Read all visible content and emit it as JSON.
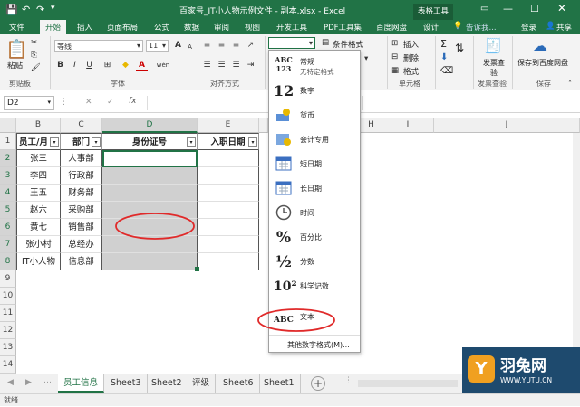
{
  "title": "百家号_IT小人物示例文件 - 副本.xlsx - Excel",
  "context_tab": "表格工具",
  "tabs": [
    "文件",
    "开始",
    "插入",
    "页面布局",
    "公式",
    "数据",
    "审阅",
    "视图",
    "开发工具",
    "PDF工具集",
    "百度网盘",
    "设计"
  ],
  "tell_me": "告诉我...",
  "login": "登录",
  "share": "共享",
  "ribbon": {
    "paste": "粘贴",
    "clipboard": "剪贴板",
    "font_name": "等线",
    "font_size": "11",
    "font_group": "字体",
    "align_group": "对齐方式",
    "cond_format": "条件格式",
    "insert": "插入",
    "delete": "删除",
    "format": "格式",
    "cells_group": "单元格",
    "invoice_check": "发票查验",
    "save_baidu": "保存到百度网盘",
    "invoice_group": "发票查验",
    "save_group": "保存",
    "bold": "B",
    "italic": "I",
    "underline": "U",
    "font_a": "A",
    "wen": "wén",
    "grow_a": "A",
    "shrink_a": "A"
  },
  "name_box": "D2",
  "fx": "fx",
  "columns": [
    "B",
    "C",
    "D",
    "E",
    "H",
    "I",
    "J"
  ],
  "rows": [
    "1",
    "2",
    "3",
    "4",
    "5",
    "6",
    "7",
    "8",
    "9",
    "10",
    "11",
    "12",
    "13",
    "14"
  ],
  "table": {
    "headers": [
      "员工/月",
      "部门",
      "身份证号",
      "入职日期"
    ],
    "data": [
      [
        "张三",
        "人事部"
      ],
      [
        "李四",
        "行政部"
      ],
      [
        "王五",
        "财务部"
      ],
      [
        "赵六",
        "采购部"
      ],
      [
        "黄七",
        "销售部"
      ],
      [
        "张小村",
        "总经办"
      ],
      [
        "IT小人物",
        "信息部"
      ]
    ]
  },
  "number_format_menu": {
    "items": [
      {
        "icon": "ABC 123",
        "label": "常规",
        "sub": "无特定格式"
      },
      {
        "icon": "12",
        "label": "数字"
      },
      {
        "icon": "currency",
        "label": "货币"
      },
      {
        "icon": "accounting",
        "label": "会计专用"
      },
      {
        "icon": "calendar",
        "label": "短日期"
      },
      {
        "icon": "calendar",
        "label": "长日期"
      },
      {
        "icon": "clock",
        "label": "时间"
      },
      {
        "icon": "%",
        "label": "百分比"
      },
      {
        "icon": "½",
        "label": "分数"
      },
      {
        "icon": "10²",
        "label": "科学记数"
      },
      {
        "icon": "ABC",
        "label": "文本"
      }
    ],
    "more": "其他数字格式(M)..."
  },
  "sheets": [
    "员工信息",
    "Sheet3",
    "Sheet2",
    "评级",
    "Sheet6",
    "Sheet1"
  ],
  "status": "就绪",
  "watermark": {
    "brand": "羽兔网",
    "url": "WWW.YUTU.CN"
  },
  "colors": {
    "excel_green": "#217346",
    "highlight_red": "#e02a2a"
  }
}
